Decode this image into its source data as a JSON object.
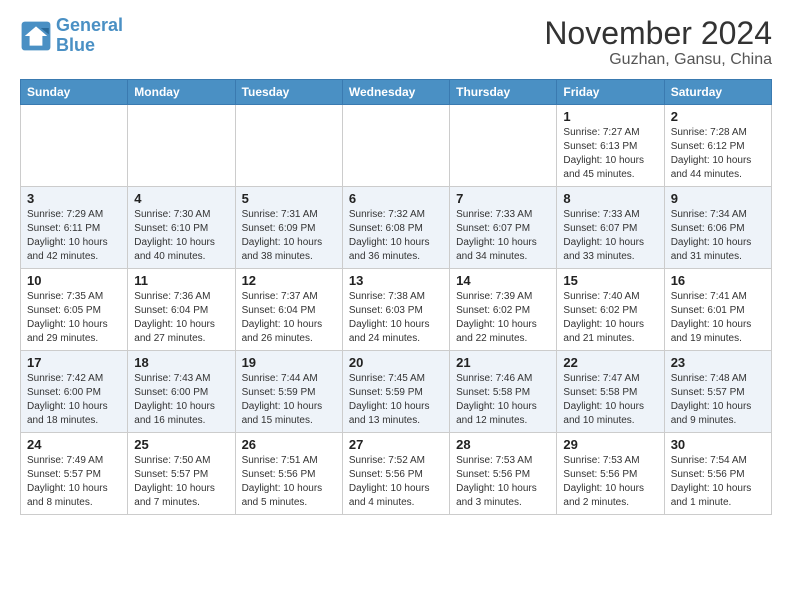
{
  "header": {
    "logo_line1": "General",
    "logo_line2": "Blue",
    "title": "November 2024",
    "subtitle": "Guzhan, Gansu, China"
  },
  "days_of_week": [
    "Sunday",
    "Monday",
    "Tuesday",
    "Wednesday",
    "Thursday",
    "Friday",
    "Saturday"
  ],
  "weeks": [
    [
      {
        "day": "",
        "info": ""
      },
      {
        "day": "",
        "info": ""
      },
      {
        "day": "",
        "info": ""
      },
      {
        "day": "",
        "info": ""
      },
      {
        "day": "",
        "info": ""
      },
      {
        "day": "1",
        "info": "Sunrise: 7:27 AM\nSunset: 6:13 PM\nDaylight: 10 hours\nand 45 minutes."
      },
      {
        "day": "2",
        "info": "Sunrise: 7:28 AM\nSunset: 6:12 PM\nDaylight: 10 hours\nand 44 minutes."
      }
    ],
    [
      {
        "day": "3",
        "info": "Sunrise: 7:29 AM\nSunset: 6:11 PM\nDaylight: 10 hours\nand 42 minutes."
      },
      {
        "day": "4",
        "info": "Sunrise: 7:30 AM\nSunset: 6:10 PM\nDaylight: 10 hours\nand 40 minutes."
      },
      {
        "day": "5",
        "info": "Sunrise: 7:31 AM\nSunset: 6:09 PM\nDaylight: 10 hours\nand 38 minutes."
      },
      {
        "day": "6",
        "info": "Sunrise: 7:32 AM\nSunset: 6:08 PM\nDaylight: 10 hours\nand 36 minutes."
      },
      {
        "day": "7",
        "info": "Sunrise: 7:33 AM\nSunset: 6:07 PM\nDaylight: 10 hours\nand 34 minutes."
      },
      {
        "day": "8",
        "info": "Sunrise: 7:33 AM\nSunset: 6:07 PM\nDaylight: 10 hours\nand 33 minutes."
      },
      {
        "day": "9",
        "info": "Sunrise: 7:34 AM\nSunset: 6:06 PM\nDaylight: 10 hours\nand 31 minutes."
      }
    ],
    [
      {
        "day": "10",
        "info": "Sunrise: 7:35 AM\nSunset: 6:05 PM\nDaylight: 10 hours\nand 29 minutes."
      },
      {
        "day": "11",
        "info": "Sunrise: 7:36 AM\nSunset: 6:04 PM\nDaylight: 10 hours\nand 27 minutes."
      },
      {
        "day": "12",
        "info": "Sunrise: 7:37 AM\nSunset: 6:04 PM\nDaylight: 10 hours\nand 26 minutes."
      },
      {
        "day": "13",
        "info": "Sunrise: 7:38 AM\nSunset: 6:03 PM\nDaylight: 10 hours\nand 24 minutes."
      },
      {
        "day": "14",
        "info": "Sunrise: 7:39 AM\nSunset: 6:02 PM\nDaylight: 10 hours\nand 22 minutes."
      },
      {
        "day": "15",
        "info": "Sunrise: 7:40 AM\nSunset: 6:02 PM\nDaylight: 10 hours\nand 21 minutes."
      },
      {
        "day": "16",
        "info": "Sunrise: 7:41 AM\nSunset: 6:01 PM\nDaylight: 10 hours\nand 19 minutes."
      }
    ],
    [
      {
        "day": "17",
        "info": "Sunrise: 7:42 AM\nSunset: 6:00 PM\nDaylight: 10 hours\nand 18 minutes."
      },
      {
        "day": "18",
        "info": "Sunrise: 7:43 AM\nSunset: 6:00 PM\nDaylight: 10 hours\nand 16 minutes."
      },
      {
        "day": "19",
        "info": "Sunrise: 7:44 AM\nSunset: 5:59 PM\nDaylight: 10 hours\nand 15 minutes."
      },
      {
        "day": "20",
        "info": "Sunrise: 7:45 AM\nSunset: 5:59 PM\nDaylight: 10 hours\nand 13 minutes."
      },
      {
        "day": "21",
        "info": "Sunrise: 7:46 AM\nSunset: 5:58 PM\nDaylight: 10 hours\nand 12 minutes."
      },
      {
        "day": "22",
        "info": "Sunrise: 7:47 AM\nSunset: 5:58 PM\nDaylight: 10 hours\nand 10 minutes."
      },
      {
        "day": "23",
        "info": "Sunrise: 7:48 AM\nSunset: 5:57 PM\nDaylight: 10 hours\nand 9 minutes."
      }
    ],
    [
      {
        "day": "24",
        "info": "Sunrise: 7:49 AM\nSunset: 5:57 PM\nDaylight: 10 hours\nand 8 minutes."
      },
      {
        "day": "25",
        "info": "Sunrise: 7:50 AM\nSunset: 5:57 PM\nDaylight: 10 hours\nand 7 minutes."
      },
      {
        "day": "26",
        "info": "Sunrise: 7:51 AM\nSunset: 5:56 PM\nDaylight: 10 hours\nand 5 minutes."
      },
      {
        "day": "27",
        "info": "Sunrise: 7:52 AM\nSunset: 5:56 PM\nDaylight: 10 hours\nand 4 minutes."
      },
      {
        "day": "28",
        "info": "Sunrise: 7:53 AM\nSunset: 5:56 PM\nDaylight: 10 hours\nand 3 minutes."
      },
      {
        "day": "29",
        "info": "Sunrise: 7:53 AM\nSunset: 5:56 PM\nDaylight: 10 hours\nand 2 minutes."
      },
      {
        "day": "30",
        "info": "Sunrise: 7:54 AM\nSunset: 5:56 PM\nDaylight: 10 hours\nand 1 minute."
      }
    ]
  ]
}
